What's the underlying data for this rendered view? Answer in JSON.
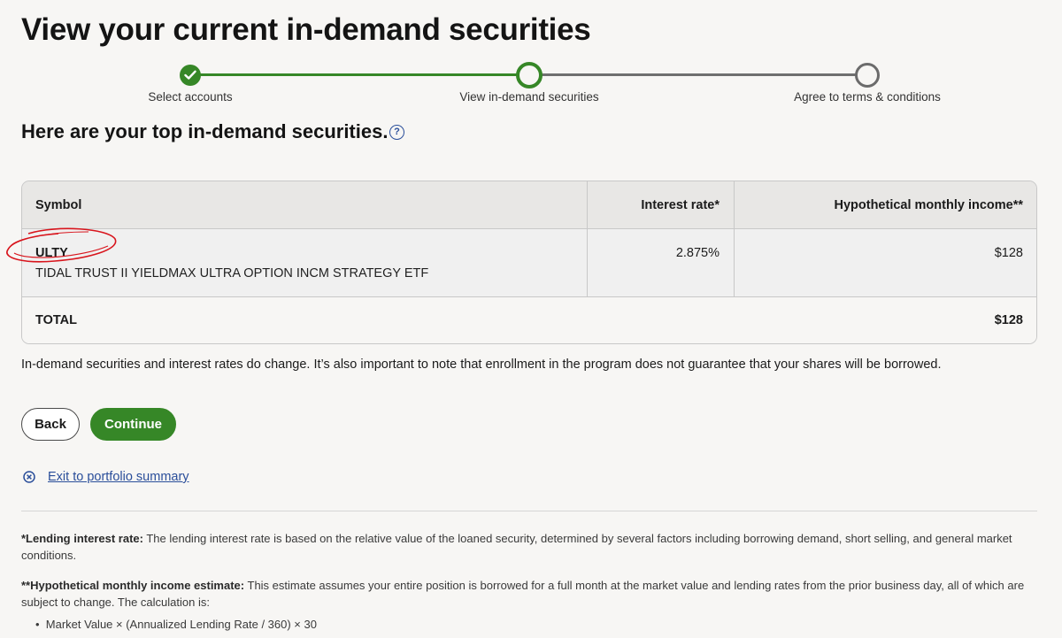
{
  "page": {
    "title": "View your current in-demand securities"
  },
  "stepper": {
    "steps": [
      {
        "label": "Select accounts",
        "state": "complete"
      },
      {
        "label": "View in-demand securities",
        "state": "current"
      },
      {
        "label": "Agree to terms & conditions",
        "state": "upcoming"
      }
    ],
    "complete_color": "#368727",
    "upcoming_color": "#6b6b6b"
  },
  "section": {
    "heading": "Here are your top in-demand securities.",
    "help_icon": "question-circle-icon"
  },
  "table": {
    "headers": {
      "symbol": "Symbol",
      "rate": "Interest rate*",
      "income": "Hypothetical monthly income**"
    },
    "rows": [
      {
        "symbol": "ULTY",
        "description": "TIDAL TRUST II YIELDMAX ULTRA OPTION INCM STRATEGY ETF",
        "rate": "2.875%",
        "income": "$128"
      }
    ],
    "total": {
      "label": "TOTAL",
      "value": "$128"
    }
  },
  "note": "In-demand securities and interest rates do change. It’s also important to note that enrollment in the program does not guarantee that your shares will be borrowed.",
  "buttons": {
    "back": "Back",
    "continue": "Continue",
    "continue_color": "#368727"
  },
  "exit_link": {
    "label": "Exit to portfolio summary",
    "icon": "x-circle-icon"
  },
  "footnotes": {
    "lending_title": "*Lending interest rate:",
    "lending_text": " The lending interest rate is based on the relative value of the loaned security, determined by several factors including borrowing demand, short selling, and general market conditions.",
    "income_title": "**Hypothetical monthly income estimate:",
    "income_text": " This estimate assumes your entire position is borrowed for a full month at the market value and lending rates from the prior business day, all of which are subject to change. The calculation is:",
    "formula": "Market Value × (Annualized Lending Rate / 360) × 30"
  }
}
